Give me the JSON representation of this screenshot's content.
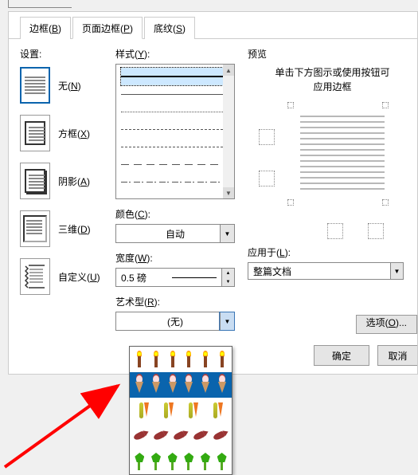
{
  "tabs": {
    "borders": {
      "label": "边框(",
      "key": "B",
      "suffix": ")"
    },
    "page_borders": {
      "label": "页面边框(",
      "key": "P",
      "suffix": ")"
    },
    "shading": {
      "label": "底纹(",
      "key": "S",
      "suffix": ")"
    }
  },
  "settings": {
    "label": "设置:",
    "items": [
      {
        "id": "none",
        "label": "无(",
        "key": "N",
        "suffix": ")"
      },
      {
        "id": "box",
        "label": "方框(",
        "key": "X",
        "suffix": ")"
      },
      {
        "id": "shadow",
        "label": "阴影(",
        "key": "A",
        "suffix": ")"
      },
      {
        "id": "threeD",
        "label": "三维(",
        "key": "D",
        "suffix": ")"
      },
      {
        "id": "custom",
        "label": "自定义(",
        "key": "U",
        "suffix": ")"
      }
    ]
  },
  "style": {
    "label": "样式(",
    "key": "Y",
    "suffix": "):"
  },
  "color": {
    "label": "颜色(",
    "key": "C",
    "suffix": "):",
    "value": "自动"
  },
  "width": {
    "label": "宽度(",
    "key": "W",
    "suffix": "):",
    "value": "0.5 磅"
  },
  "art": {
    "label": "艺术型(",
    "key": "R",
    "suffix": "):",
    "value": "(无)"
  },
  "preview": {
    "label": "预览",
    "hint1": "单击下方图示或使用按钮可",
    "hint2": "应用边框"
  },
  "apply_to": {
    "label": "应用于(",
    "key": "L",
    "suffix": "):",
    "value": "整篇文档"
  },
  "buttons": {
    "options": "选项(",
    "options_key": "O",
    "options_suffix": ")...",
    "ok": "确定",
    "cancel": "取消"
  }
}
